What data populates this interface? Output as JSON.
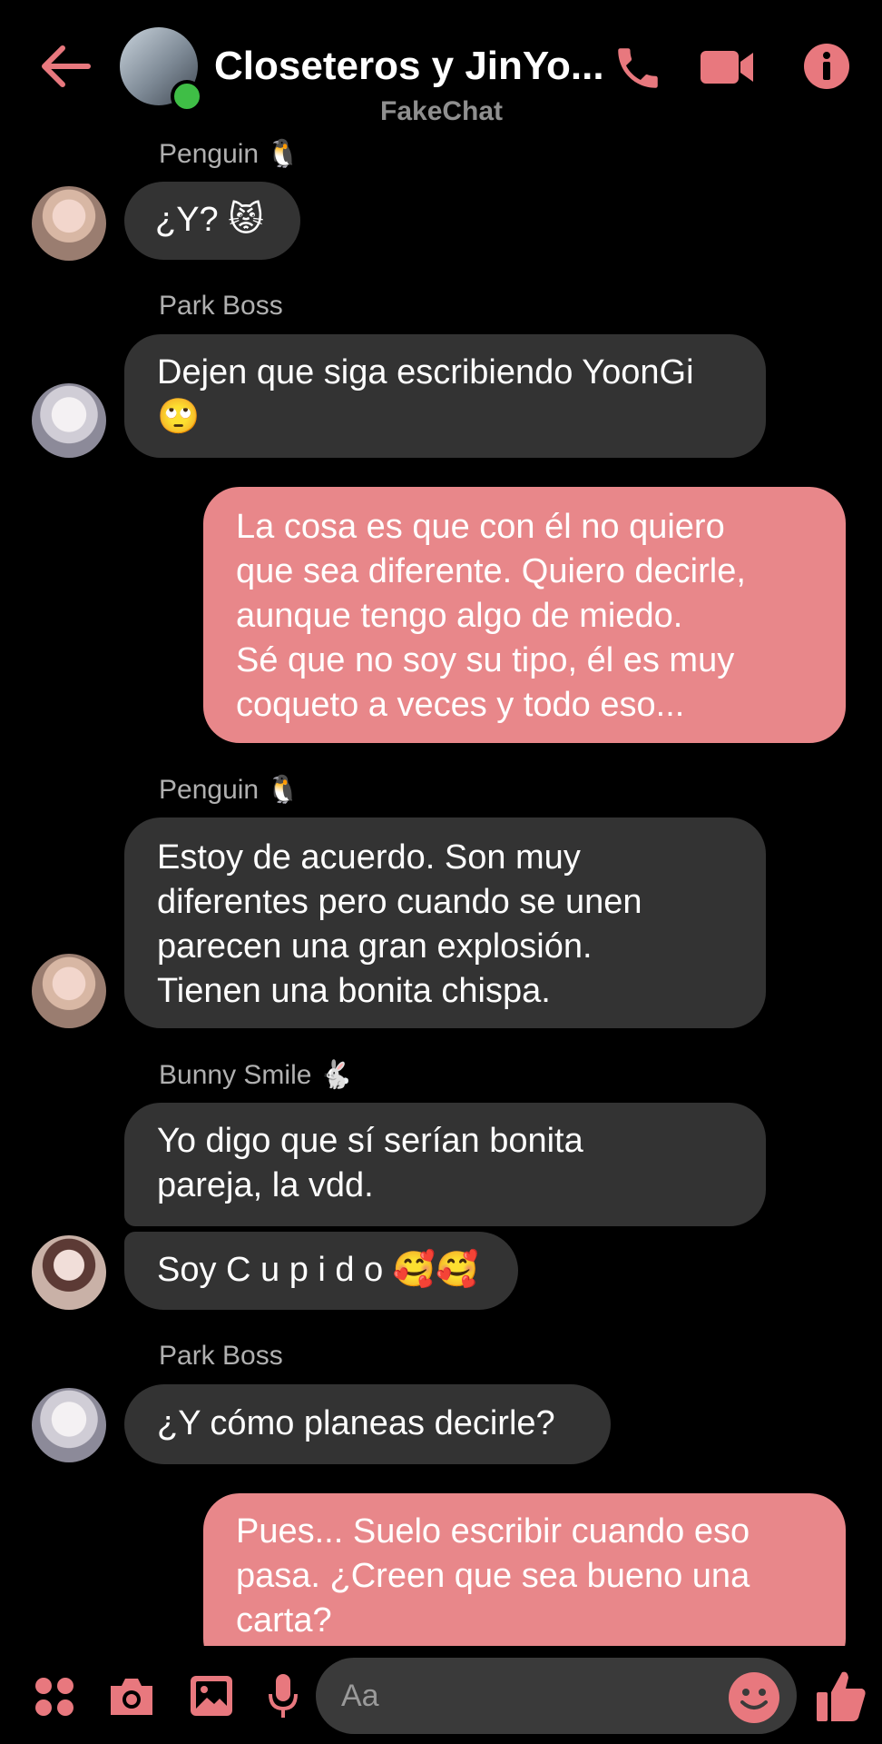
{
  "header": {
    "title": "Closeteros y JinYo...",
    "subtitle": "FakeChat",
    "icons": [
      "back-arrow-icon",
      "phone-icon",
      "video-icon",
      "info-icon"
    ],
    "accent_color": "#e8787e"
  },
  "messages": [
    {
      "sender": "Penguin 🐧",
      "text": [
        "¿Y? 😾"
      ]
    },
    {
      "sender": "Park Boss",
      "text": [
        "Dejen que siga escribiendo YoonGi",
        "🙄"
      ]
    },
    {
      "sender": "",
      "outgoing": true,
      "text": [
        "La cosa es que con él no quiero",
        "que sea diferente. Quiero decirle,",
        "aunque tengo algo de miedo.",
        "Sé que no soy su tipo, él es muy",
        "coqueto a veces y todo eso..."
      ]
    },
    {
      "sender": "Penguin 🐧",
      "text": [
        "Estoy de acuerdo. Son muy",
        "diferentes pero cuando se unen",
        "parecen una gran explosión.",
        "Tienen una bonita chispa."
      ]
    },
    {
      "sender": "Bunny Smile 🐇",
      "text": [
        "Yo digo que sí serían bonita",
        "pareja, la vdd."
      ]
    },
    {
      "sender": "",
      "text": [
        "Soy C u p i d o 🥰🥰"
      ]
    },
    {
      "sender": "Park Boss",
      "text": [
        "¿Y cómo planeas decirle?"
      ]
    },
    {
      "sender": "",
      "outgoing": true,
      "text": [
        "Pues... Suelo escribir cuando eso",
        "pasa. ¿Creen que sea bueno una",
        "carta?"
      ]
    }
  ],
  "composer": {
    "placeholder": "Aa",
    "icons": [
      "apps-icon",
      "camera-icon",
      "gallery-icon",
      "microphone-icon",
      "emoji-icon",
      "thumbs-up-icon"
    ]
  }
}
